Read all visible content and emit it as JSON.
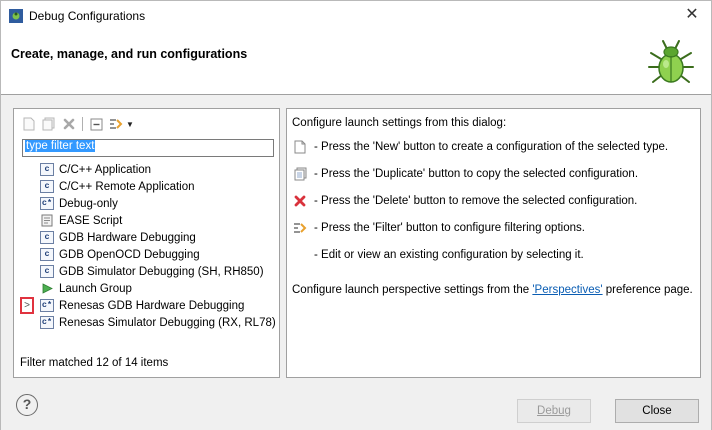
{
  "window": {
    "title": "Debug Configurations",
    "close_glyph": "✕",
    "banner_title": "Create, manage, and run configurations"
  },
  "toolbar": {
    "icons": [
      "new-config-icon",
      "duplicate-icon",
      "delete-icon",
      "collapse-all-icon",
      "filter-icon",
      "dropdown-arrow-icon"
    ]
  },
  "filter": {
    "value": "type filter text"
  },
  "tree": {
    "items": [
      {
        "label": "C/C++ Application",
        "icon": "c"
      },
      {
        "label": "C/C++ Remote Application",
        "icon": "c"
      },
      {
        "label": "Debug-only",
        "icon": "c*"
      },
      {
        "label": "EASE Script",
        "icon": "script"
      },
      {
        "label": "GDB Hardware Debugging",
        "icon": "c"
      },
      {
        "label": "GDB OpenOCD Debugging",
        "icon": "c"
      },
      {
        "label": "GDB Simulator Debugging (SH, RH850)",
        "icon": "c"
      },
      {
        "label": "Launch Group",
        "icon": "launch"
      },
      {
        "label": "Renesas GDB Hardware Debugging",
        "icon": "c*"
      },
      {
        "label": "Renesas Simulator Debugging (RX, RL78)",
        "icon": "c*"
      }
    ],
    "expand_glyph": ">"
  },
  "status": {
    "text": "Filter matched 12 of 14 items"
  },
  "right": {
    "intro": "Configure launch settings from this dialog:",
    "lines": [
      "- Press the 'New' button to create a configuration of the selected type.",
      "- Press the 'Duplicate' button to copy the selected configuration.",
      "- Press the 'Delete' button to remove the selected configuration.",
      "- Press the 'Filter' button to configure filtering options.",
      "- Edit or view an existing configuration by selecting it."
    ],
    "perspectives_prefix": "Configure launch perspective settings from the ",
    "perspectives_link": "'Perspectives'",
    "perspectives_suffix": " preference page."
  },
  "footer": {
    "help_glyph": "?",
    "debug_label": "Debug",
    "close_label": "Close"
  }
}
